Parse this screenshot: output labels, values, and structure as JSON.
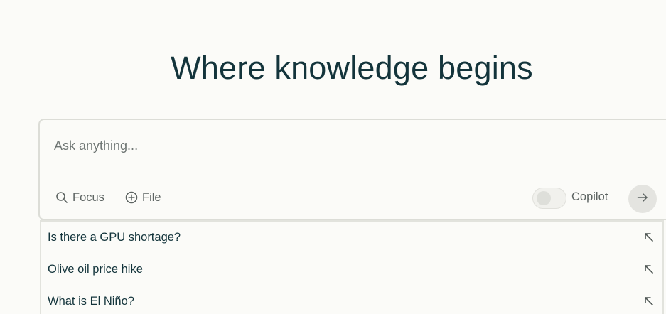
{
  "hero": {
    "title": "Where knowledge begins"
  },
  "search": {
    "placeholder": "Ask anything...",
    "value": "",
    "focus_label": "Focus",
    "file_label": "File",
    "copilot_label": "Copilot",
    "copilot_enabled": false
  },
  "suggestions": [
    {
      "label": "Is there a GPU shortage?"
    },
    {
      "label": "Olive oil price hike"
    },
    {
      "label": "What is El Niño?"
    }
  ],
  "icons": {
    "focus": "search-icon",
    "file": "plus-circle-icon",
    "submit": "arrow-right-icon",
    "suggestion": "arrow-up-left-icon"
  },
  "colors": {
    "text": "#13343b",
    "muted": "#5d6462",
    "background": "#fbfbf8",
    "border": "#dcddd7"
  }
}
